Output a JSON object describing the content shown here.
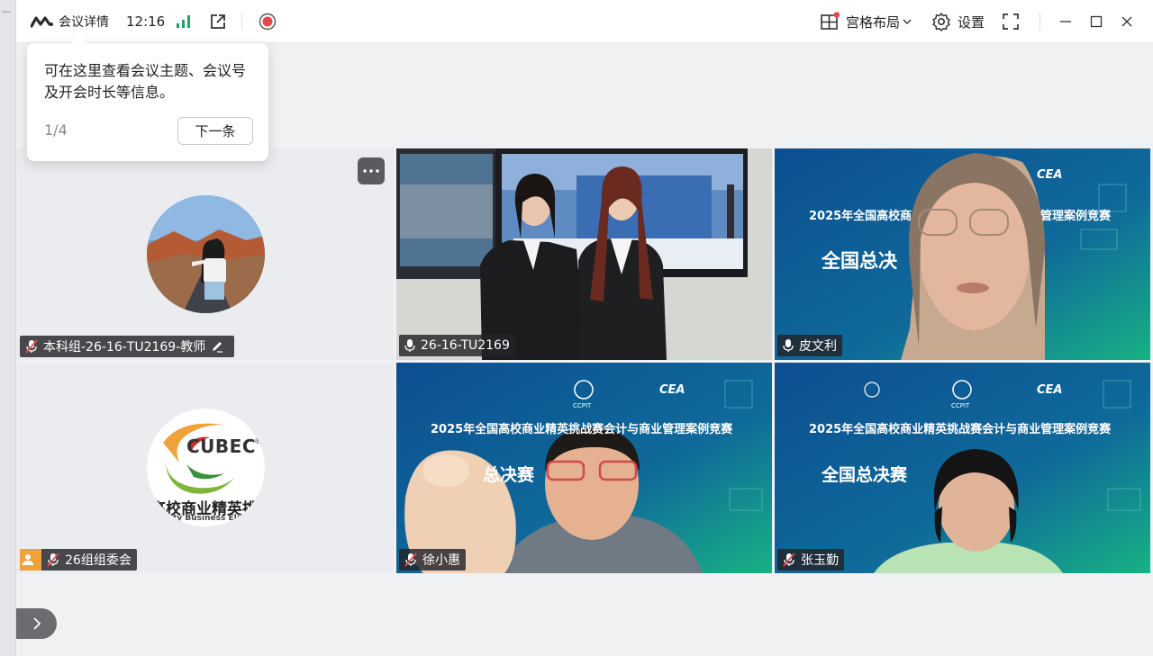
{
  "topbar": {
    "meeting_info_label": "会议详情",
    "time": "12:16",
    "layout_label": "宫格布局",
    "settings_label": "设置"
  },
  "tooltip": {
    "text": "可在这里查看会议主题、会议号及开会时长等信息。",
    "page": "1/4",
    "next_label": "下一条"
  },
  "participants": [
    {
      "name": "本科组-26-16-TU2169-教师",
      "mic": "muted"
    },
    {
      "name": "26-16-TU2169",
      "mic": "on"
    },
    {
      "name": "皮文利",
      "mic": "on"
    },
    {
      "name": "26组组委会",
      "mic": "muted"
    },
    {
      "name": "徐小惠",
      "mic": "muted"
    },
    {
      "name": "张玉勤",
      "mic": "muted"
    }
  ],
  "slides": {
    "competition_title": "2025年全国高校商业精英挑战赛会计与商业管理案例竞赛",
    "competition_title_partial": "2025年全国高校商",
    "competition_title_partial_right": "管理案例竞赛",
    "final_label": "全国总决赛",
    "final_label_partial": "全国总决",
    "final_label_partial2": "总决赛",
    "logo_cea": "CEA",
    "logo_ccpit": "CCPIT"
  },
  "logos": {
    "cubec_text": "CUBEC",
    "cubec_registered": "®",
    "cubec_cn": "高校商业精英挑",
    "cubec_en": "ity Business Eli"
  },
  "colors": {
    "accent_green": "#1aa36a",
    "record_red": "#e24b4b",
    "slide_blue": "#0f5a8c",
    "slide_green": "#17a88a"
  }
}
